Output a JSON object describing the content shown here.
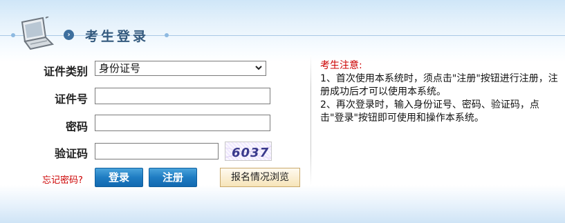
{
  "header": {
    "title": "考生登录"
  },
  "form": {
    "cert_type_label": "证件类别",
    "cert_type_selected": "身份证号",
    "cert_no_label": "证件号",
    "cert_no_value": "",
    "password_label": "密码",
    "password_value": "",
    "captcha_label": "验证码",
    "captcha_value": "",
    "captcha_image_text": "6037",
    "forgot_password": "忘记密码?",
    "login_button": "登录",
    "register_button": "注册",
    "browse_button": "报名情况浏览"
  },
  "notice": {
    "title": "考生注意:",
    "items": [
      "1、首次使用本系统时，须点击\"注册\"按钮进行注册，注册成功后才可以使用本系统。",
      "2、再次登录时，输入身份证号、密码、验证码，点击\"登录\"按钮即可使用和操作本系统。"
    ]
  },
  "colors": {
    "header_title": "#345a7e",
    "notice_title": "#cc0000",
    "forgot_link": "#cc0000",
    "button_blue": "#1f7cc2"
  },
  "icons": {
    "header_logo": "laptop-icon",
    "header_bullet": "chevron-right-circle-icon",
    "select_arrow": "chevron-down-icon"
  }
}
